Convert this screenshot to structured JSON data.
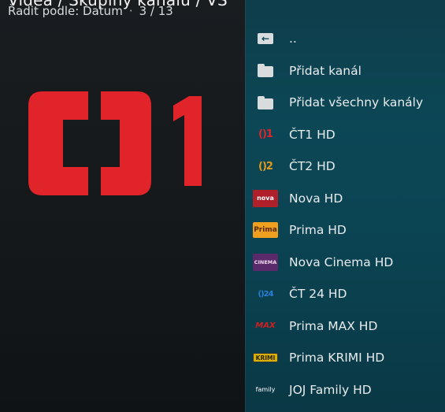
{
  "header": {
    "path": "Videa / Skupiny kanálů / VŠ",
    "sort_label": "Řadit podle: Datum",
    "separator": "·",
    "position": "3 / 13"
  },
  "preview": {
    "logo_text": "ČT1",
    "colors": {
      "logo": "#e0242a"
    }
  },
  "list": {
    "items": [
      {
        "label": "..",
        "icon": "back-folder-icon"
      },
      {
        "label": "Přidat kanál",
        "icon": "folder-icon"
      },
      {
        "label": "Přidat všechny kanály",
        "icon": "folder-icon"
      },
      {
        "label": "ČT1 HD",
        "icon": "ct1-logo-icon",
        "icon_text": "()1"
      },
      {
        "label": "ČT2 HD",
        "icon": "ct2-logo-icon",
        "icon_text": "()2"
      },
      {
        "label": "Nova HD",
        "icon": "nova-logo-icon",
        "icon_text": "nova"
      },
      {
        "label": "Prima HD",
        "icon": "prima-logo-icon",
        "icon_text": "Prima"
      },
      {
        "label": "Nova Cinema HD",
        "icon": "nova-cinema-logo-icon",
        "icon_text": "CINEMA"
      },
      {
        "label": "ČT 24 HD",
        "icon": "ct24-logo-icon",
        "icon_text": "()24"
      },
      {
        "label": "Prima MAX HD",
        "icon": "prima-max-logo-icon",
        "icon_text": "MAX"
      },
      {
        "label": "Prima KRIMI HD",
        "icon": "prima-krimi-logo-icon",
        "icon_text": "KRIMI"
      },
      {
        "label": "JOJ Family HD",
        "icon": "joj-family-logo-icon",
        "icon_text": "family"
      }
    ]
  },
  "colors": {
    "accent_panel": "#0c4756",
    "ct1_red": "#e0242a",
    "ct2_orange": "#e39c1a",
    "ct24_blue": "#2a7fd6"
  }
}
